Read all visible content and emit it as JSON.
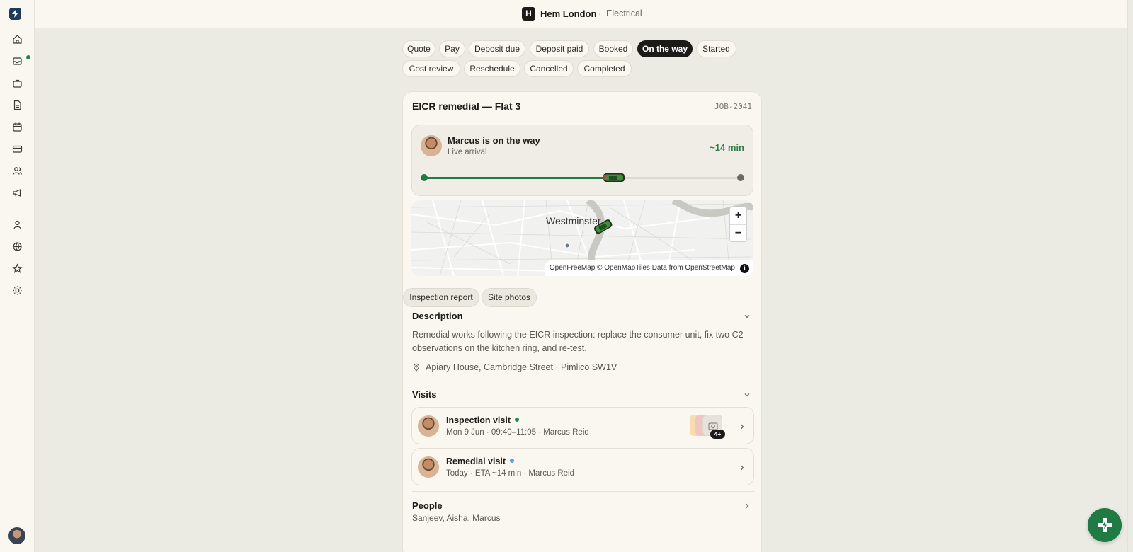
{
  "app": {
    "org_initial": "H",
    "org_name": "Hem London",
    "separator": "·",
    "trade": "Electrical",
    "accent": "#1f7a44"
  },
  "sidebar": {
    "items": [
      {
        "icon": "home-icon"
      },
      {
        "icon": "inbox-icon",
        "badge": true
      },
      {
        "icon": "briefcase-icon"
      },
      {
        "icon": "document-icon"
      },
      {
        "icon": "calendar-icon"
      },
      {
        "icon": "credit-card-icon"
      },
      {
        "icon": "users-icon"
      },
      {
        "icon": "megaphone-icon"
      },
      {
        "icon": "person-icon"
      },
      {
        "icon": "globe-icon"
      },
      {
        "icon": "star-icon"
      },
      {
        "icon": "sun-icon"
      }
    ]
  },
  "statuses": [
    {
      "label": "Quote"
    },
    {
      "label": "Pay"
    },
    {
      "label": "Deposit due"
    },
    {
      "label": "Deposit paid"
    },
    {
      "label": "Booked"
    },
    {
      "label": "On the way",
      "active": true
    },
    {
      "label": "Started"
    },
    {
      "label": "Cost review"
    },
    {
      "label": "Reschedule"
    },
    {
      "label": "Cancelled"
    },
    {
      "label": "Completed"
    }
  ],
  "job": {
    "title": "EICR remedial — Flat 3",
    "id": "JOB-2041"
  },
  "eta": {
    "title": "Marcus is on the way",
    "subtitle": "Live arrival",
    "time": "~14 min",
    "progress": 0.6
  },
  "map": {
    "place_label": "Westminster",
    "zoom_in": "+",
    "zoom_out": "−",
    "attribution": "OpenFreeMap © OpenMapTiles Data from OpenStreetMap",
    "info": "i"
  },
  "tabs": [
    {
      "label": "Inspection report"
    },
    {
      "label": "Site photos"
    }
  ],
  "description": {
    "title": "Description",
    "text": "Remedial works following the EICR inspection: replace the consumer unit, fix two C2 observations on the kitchen ring, and re-test.",
    "address": "Apiary House, Cambridge Street · Pimlico SW1V"
  },
  "visits": {
    "title": "Visits",
    "items": [
      {
        "title": "Inspection visit",
        "status_color": "#1f8a4c",
        "meta": "Mon 9 Jun · 09:40–11:05 · Marcus Reid",
        "photo_count": "4+"
      },
      {
        "title": "Remedial visit",
        "status_color": "#5b9be0",
        "meta": "Today · ETA ~14 min · Marcus Reid"
      }
    ]
  },
  "people": {
    "title": "People",
    "names": "Sanjeev, Aisha, Marcus"
  }
}
